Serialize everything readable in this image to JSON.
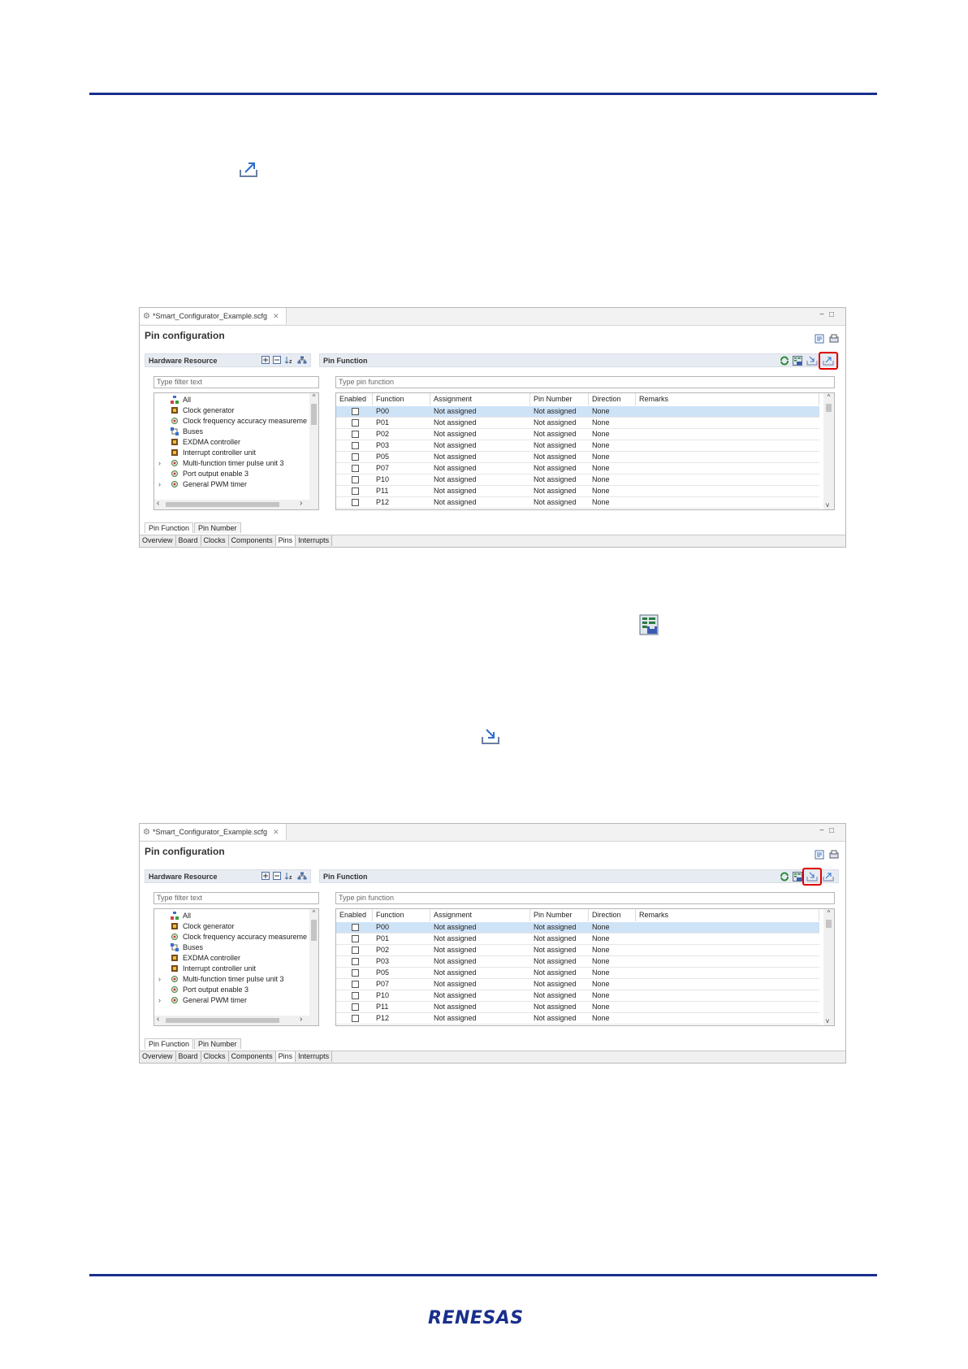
{
  "colors": {
    "rule": "#1a2f8c",
    "highlight": "#e00000",
    "selected_row": "#cfe3f7"
  },
  "logo_text": "RENESAS",
  "inline_icons": [
    "export-icon",
    "save-report-icon",
    "import-icon"
  ],
  "screenshots": [
    {
      "highlighted_button": "export-board-settings"
    },
    {
      "highlighted_button": "import-board-settings"
    }
  ],
  "editor": {
    "file_tab": "*Smart_Configurator_Example.scfg",
    "title": "Pin configuration",
    "hardware_resource": {
      "header": "Hardware Resource",
      "filter_placeholder": "Type filter text",
      "items": [
        {
          "label": "All",
          "icon": "all-icon",
          "expandable": false
        },
        {
          "label": "Clock generator",
          "icon": "chip-icon",
          "expandable": false
        },
        {
          "label": "Clock frequency accuracy measureme",
          "icon": "gear-icon",
          "expandable": false
        },
        {
          "label": "Buses",
          "icon": "bus-icon",
          "expandable": false
        },
        {
          "label": "EXDMA controller",
          "icon": "chip-icon",
          "expandable": false
        },
        {
          "label": "Interrupt controller unit",
          "icon": "chip-icon",
          "expandable": false
        },
        {
          "label": "Multi-function timer pulse unit 3",
          "icon": "gear-icon",
          "expandable": true
        },
        {
          "label": "Port output enable 3",
          "icon": "gear-icon",
          "expandable": false
        },
        {
          "label": "General PWM timer",
          "icon": "gear-icon",
          "expandable": true
        }
      ]
    },
    "pin_function": {
      "header": "Pin Function",
      "filter_placeholder": "Type pin function",
      "columns": [
        "Enabled",
        "Function",
        "Assignment",
        "Pin Number",
        "Direction",
        "Remarks"
      ],
      "rows": [
        {
          "function": "P00",
          "assignment": "Not assigned",
          "pin_number": "Not assigned",
          "direction": "None",
          "remarks": ""
        },
        {
          "function": "P01",
          "assignment": "Not assigned",
          "pin_number": "Not assigned",
          "direction": "None",
          "remarks": ""
        },
        {
          "function": "P02",
          "assignment": "Not assigned",
          "pin_number": "Not assigned",
          "direction": "None",
          "remarks": ""
        },
        {
          "function": "P03",
          "assignment": "Not assigned",
          "pin_number": "Not assigned",
          "direction": "None",
          "remarks": ""
        },
        {
          "function": "P05",
          "assignment": "Not assigned",
          "pin_number": "Not assigned",
          "direction": "None",
          "remarks": ""
        },
        {
          "function": "P07",
          "assignment": "Not assigned",
          "pin_number": "Not assigned",
          "direction": "None",
          "remarks": ""
        },
        {
          "function": "P10",
          "assignment": "Not assigned",
          "pin_number": "Not assigned",
          "direction": "None",
          "remarks": ""
        },
        {
          "function": "P11",
          "assignment": "Not assigned",
          "pin_number": "Not assigned",
          "direction": "None",
          "remarks": ""
        },
        {
          "function": "P12",
          "assignment": "Not assigned",
          "pin_number": "Not assigned",
          "direction": "None",
          "remarks": ""
        }
      ]
    },
    "sub_tabs": [
      "Pin Function",
      "Pin Number"
    ],
    "page_tabs": [
      "Overview",
      "Board",
      "Clocks",
      "Components",
      "Pins",
      "Interrupts"
    ],
    "active_page_tab": "Pins"
  }
}
